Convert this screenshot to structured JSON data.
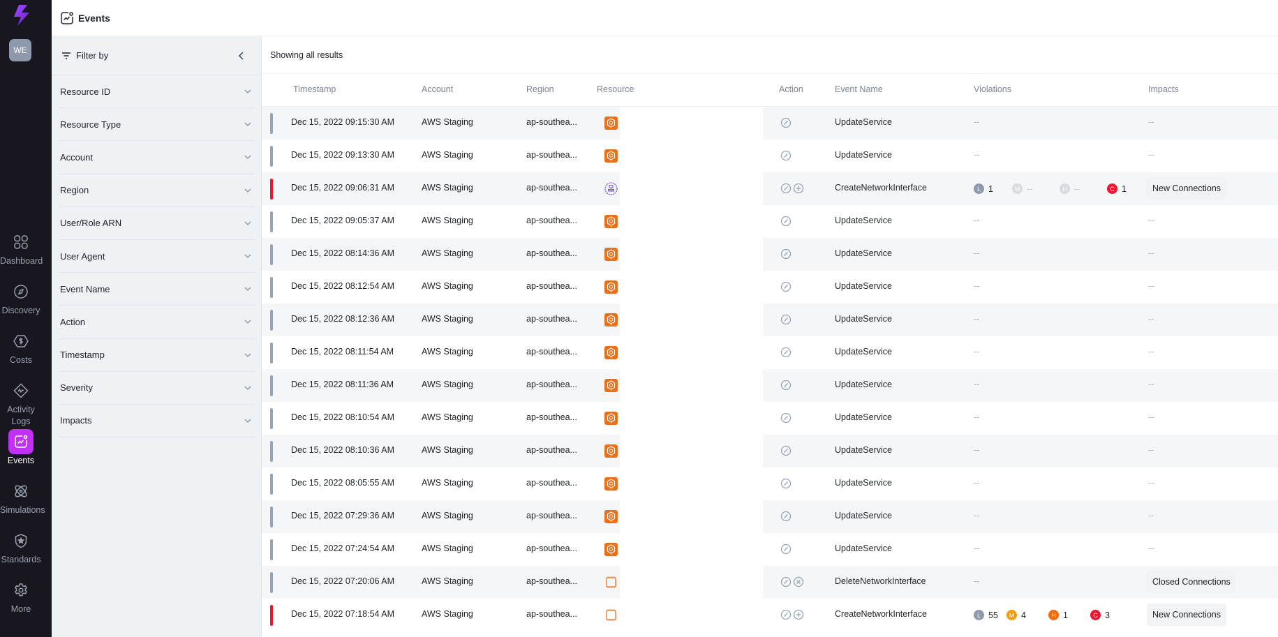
{
  "app": {
    "page_title": "Events",
    "user_initials": "WE",
    "brand_color": "#8b2cf5",
    "active_color": "#c22ff5"
  },
  "nav": [
    {
      "label": "Dashboard",
      "icon": "grid-icon"
    },
    {
      "label": "Discovery",
      "icon": "compass-icon"
    },
    {
      "label": "Costs",
      "icon": "dollar-hexagon-icon"
    },
    {
      "label": "Activity Logs",
      "icon": "activity-icon"
    },
    {
      "label": "Events",
      "icon": "events-chart-icon",
      "active": true
    },
    {
      "label": "Simulations",
      "icon": "atom-icon"
    },
    {
      "label": "Standards",
      "icon": "shield-star-icon"
    },
    {
      "label": "More",
      "icon": "gear-icon"
    }
  ],
  "filters": {
    "title": "Filter by",
    "items": [
      "Resource ID",
      "Resource Type",
      "Account",
      "Region",
      "User/Role ARN",
      "User Agent",
      "Event Name",
      "Action",
      "Timestamp",
      "Severity",
      "Impacts"
    ]
  },
  "results_label": "Showing all results",
  "table": {
    "columns": [
      "Timestamp",
      "Account",
      "Region",
      "Resource",
      "Action",
      "Event Name",
      "Violations",
      "Impacts"
    ],
    "rows": [
      {
        "timestamp": "Dec 15, 2022 09:15:30 AM",
        "account": "AWS Staging",
        "region": "ap-southea...",
        "resource": "ecs",
        "actions": [
          "modify"
        ],
        "event": "UpdateService",
        "severity": "low",
        "violations": null,
        "impact": "--"
      },
      {
        "timestamp": "Dec 15, 2022 09:13:30 AM",
        "account": "AWS Staging",
        "region": "ap-southea...",
        "resource": "ecs",
        "actions": [
          "modify"
        ],
        "event": "UpdateService",
        "severity": "low",
        "violations": null,
        "impact": "--"
      },
      {
        "timestamp": "Dec 15, 2022 09:06:31 AM",
        "account": "AWS Staging",
        "region": "ap-southea...",
        "resource": "network",
        "actions": [
          "modify",
          "create"
        ],
        "event": "CreateNetworkInterface",
        "severity": "critical",
        "violations": {
          "L": "1",
          "M": "--",
          "H": "--",
          "C": "1"
        },
        "impact": "New Connections"
      },
      {
        "timestamp": "Dec 15, 2022 09:05:37 AM",
        "account": "AWS Staging",
        "region": "ap-southea...",
        "resource": "ecs",
        "actions": [
          "modify"
        ],
        "event": "UpdateService",
        "severity": "low",
        "violations": null,
        "impact": "--"
      },
      {
        "timestamp": "Dec 15, 2022 08:14:36 AM",
        "account": "AWS Staging",
        "region": "ap-southea...",
        "resource": "ecs",
        "actions": [
          "modify"
        ],
        "event": "UpdateService",
        "severity": "low",
        "violations": null,
        "impact": "--"
      },
      {
        "timestamp": "Dec 15, 2022 08:12:54 AM",
        "account": "AWS Staging",
        "region": "ap-southea...",
        "resource": "ecs",
        "actions": [
          "modify"
        ],
        "event": "UpdateService",
        "severity": "low",
        "violations": null,
        "impact": "--"
      },
      {
        "timestamp": "Dec 15, 2022 08:12:36 AM",
        "account": "AWS Staging",
        "region": "ap-southea...",
        "resource": "ecs",
        "actions": [
          "modify"
        ],
        "event": "UpdateService",
        "severity": "low",
        "violations": null,
        "impact": "--"
      },
      {
        "timestamp": "Dec 15, 2022 08:11:54 AM",
        "account": "AWS Staging",
        "region": "ap-southea...",
        "resource": "ecs",
        "actions": [
          "modify"
        ],
        "event": "UpdateService",
        "severity": "low",
        "violations": null,
        "impact": "--"
      },
      {
        "timestamp": "Dec 15, 2022 08:11:36 AM",
        "account": "AWS Staging",
        "region": "ap-southea...",
        "resource": "ecs",
        "actions": [
          "modify"
        ],
        "event": "UpdateService",
        "severity": "low",
        "violations": null,
        "impact": "--"
      },
      {
        "timestamp": "Dec 15, 2022 08:10:54 AM",
        "account": "AWS Staging",
        "region": "ap-southea...",
        "resource": "ecs",
        "actions": [
          "modify"
        ],
        "event": "UpdateService",
        "severity": "low",
        "violations": null,
        "impact": "--"
      },
      {
        "timestamp": "Dec 15, 2022 08:10:36 AM",
        "account": "AWS Staging",
        "region": "ap-southea...",
        "resource": "ecs",
        "actions": [
          "modify"
        ],
        "event": "UpdateService",
        "severity": "low",
        "violations": null,
        "impact": "--"
      },
      {
        "timestamp": "Dec 15, 2022 08:05:55 AM",
        "account": "AWS Staging",
        "region": "ap-southea...",
        "resource": "ecs",
        "actions": [
          "modify"
        ],
        "event": "UpdateService",
        "severity": "low",
        "violations": null,
        "impact": "--"
      },
      {
        "timestamp": "Dec 15, 2022 07:29:36 AM",
        "account": "AWS Staging",
        "region": "ap-southea...",
        "resource": "ecs",
        "actions": [
          "modify"
        ],
        "event": "UpdateService",
        "severity": "low",
        "violations": null,
        "impact": "--"
      },
      {
        "timestamp": "Dec 15, 2022 07:24:54 AM",
        "account": "AWS Staging",
        "region": "ap-southea...",
        "resource": "ecs",
        "actions": [
          "modify"
        ],
        "event": "UpdateService",
        "severity": "low",
        "violations": null,
        "impact": "--"
      },
      {
        "timestamp": "Dec 15, 2022 07:20:06 AM",
        "account": "AWS Staging",
        "region": "ap-southea...",
        "resource": "ec2",
        "actions": [
          "modify",
          "delete"
        ],
        "event": "DeleteNetworkInterface",
        "severity": "low",
        "violations": null,
        "impact": "Closed Connections"
      },
      {
        "timestamp": "Dec 15, 2022 07:18:54 AM",
        "account": "AWS Staging",
        "region": "ap-southea...",
        "resource": "ec2",
        "actions": [
          "modify",
          "create"
        ],
        "event": "CreateNetworkInterface",
        "severity": "critical",
        "violations": {
          "L": "55",
          "M": "4",
          "H": "1",
          "C": "3"
        },
        "impact": "New Connections"
      }
    ]
  },
  "colors": {
    "severity_low": "#97a3b6",
    "severity_critical": "#f0142f",
    "badge_L": "#8e99ab",
    "badge_M": "#f59a0b",
    "badge_H": "#f56a0b",
    "badge_C": "#f0142f",
    "badge_muted": "#d9dbe0",
    "resource_orange": "#e8711c",
    "resource_purple": "#7a4fd6"
  }
}
